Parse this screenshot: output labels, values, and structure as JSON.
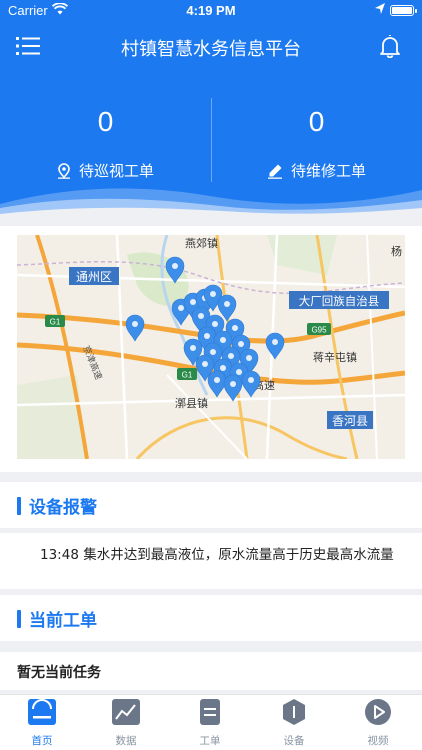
{
  "status_bar": {
    "carrier": "Carrier",
    "time": "4:19 PM"
  },
  "header": {
    "title": "村镇智慧水务信息平台",
    "stats": [
      {
        "value": "0",
        "label": "待巡视工单",
        "icon": "location-pin-icon"
      },
      {
        "value": "0",
        "label": "待维修工单",
        "icon": "pen-edit-icon"
      }
    ]
  },
  "map": {
    "labels": {
      "tongzhou": "通州区",
      "yanjiao": "燕郊镇",
      "dachang": "大厂回族自治县",
      "jiangxintun": "蒋辛屯镇",
      "xianghe": "香河县",
      "lixian": "漷县镇",
      "yang": "杨",
      "gaosu": "高速",
      "g1_a": "G1",
      "g1_b": "G1",
      "g95": "G95",
      "road_vertical": "京津高速"
    },
    "marker_count": 24
  },
  "alarm": {
    "title": "设备报警",
    "message": "13:48 集水井达到最高液位，原水流量高于历史最高水流量"
  },
  "task": {
    "title": "当前工单",
    "empty_text": "暂无当前任务"
  },
  "tabbar": {
    "items": [
      {
        "label": "首页",
        "icon": "home-icon",
        "active": true
      },
      {
        "label": "数据",
        "icon": "chart-icon",
        "active": false
      },
      {
        "label": "工单",
        "icon": "work-order-icon",
        "active": false
      },
      {
        "label": "设备",
        "icon": "device-icon",
        "active": false
      },
      {
        "label": "视频",
        "icon": "video-play-icon",
        "active": false
      }
    ]
  },
  "colors": {
    "primary": "#1d79ef",
    "marker": "#3d8ee8",
    "tab_inactive": "#8a93a3"
  }
}
